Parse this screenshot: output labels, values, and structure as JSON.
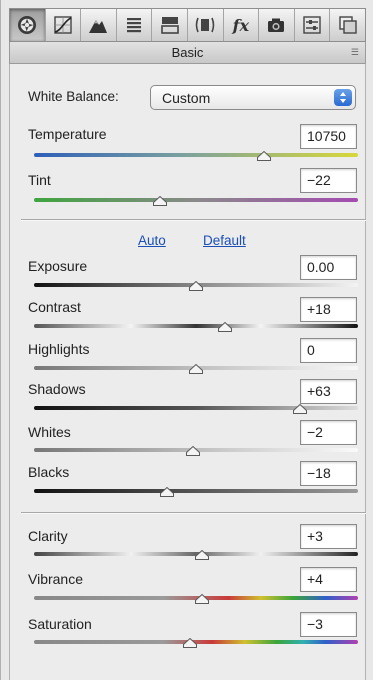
{
  "toolbar": {
    "tabs": [
      {
        "name": "basic-tab",
        "icon": "aperture-icon",
        "active": true
      },
      {
        "name": "tone-curve-tab",
        "icon": "tone-curve-icon",
        "active": false
      },
      {
        "name": "detail-tab",
        "icon": "mountain-icon",
        "active": false
      },
      {
        "name": "hsl-tab",
        "icon": "hsl-bars-icon",
        "active": false
      },
      {
        "name": "split-toning-tab",
        "icon": "split-toning-icon",
        "active": false
      },
      {
        "name": "lens-corrections-tab",
        "icon": "lens-icon",
        "active": false
      },
      {
        "name": "effects-tab",
        "icon": "fx-icon",
        "label": "fx",
        "active": false
      },
      {
        "name": "camera-calibration-tab",
        "icon": "camera-icon",
        "active": false
      },
      {
        "name": "presets-tab",
        "icon": "sliders-icon",
        "active": false
      },
      {
        "name": "snapshots-tab",
        "icon": "snapshots-icon",
        "active": false
      }
    ]
  },
  "header": {
    "title": "Basic"
  },
  "white_balance": {
    "label": "White Balance:",
    "value": "Custom"
  },
  "links": {
    "auto": "Auto",
    "default": "Default"
  },
  "sliders": {
    "temperature": {
      "label": "Temperature",
      "value": "10750",
      "position": 0.71
    },
    "tint": {
      "label": "Tint",
      "value": "−22",
      "position": 0.39
    },
    "exposure": {
      "label": "Exposure",
      "value": "0.00",
      "position": 0.5
    },
    "contrast": {
      "label": "Contrast",
      "value": "+18",
      "position": 0.59
    },
    "highlights": {
      "label": "Highlights",
      "value": "0",
      "position": 0.5
    },
    "shadows": {
      "label": "Shadows",
      "value": "+63",
      "position": 0.82
    },
    "whites": {
      "label": "Whites",
      "value": "−2",
      "position": 0.49
    },
    "blacks": {
      "label": "Blacks",
      "value": "−18",
      "position": 0.41
    },
    "clarity": {
      "label": "Clarity",
      "value": "+3",
      "position": 0.52
    },
    "vibrance": {
      "label": "Vibrance",
      "value": "+4",
      "position": 0.52
    },
    "saturation": {
      "label": "Saturation",
      "value": "−3",
      "position": 0.48
    }
  },
  "colors": {
    "link": "#1b4fb5",
    "select_arrow": "#2a6ad1",
    "temperature_gradient": [
      "#2e5fb8",
      "#d8d83a"
    ],
    "tint_gradient": [
      "#3fa43f",
      "#a44bb0"
    ]
  }
}
